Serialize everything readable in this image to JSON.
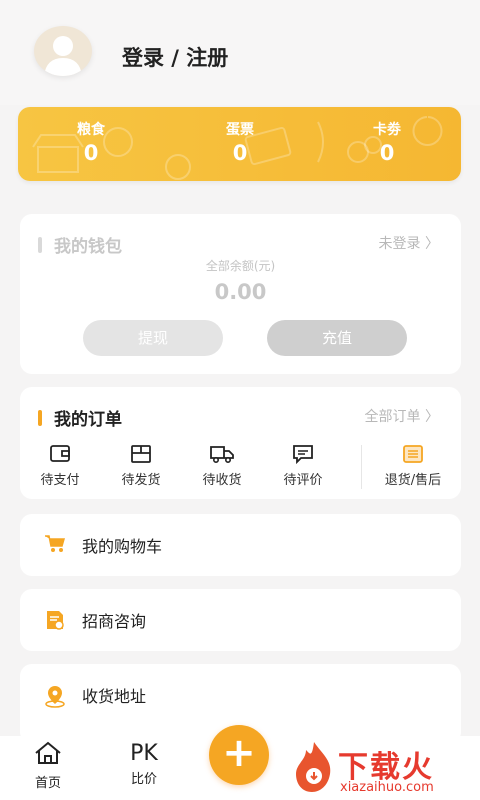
{
  "profile": {
    "login_label": "登录 / 注册"
  },
  "assets": [
    {
      "label": "粮食",
      "value": "0"
    },
    {
      "label": "蛋票",
      "value": "0"
    },
    {
      "label": "卡劵",
      "value": "0"
    }
  ],
  "wallet": {
    "title": "我的钱包",
    "status": "未登录 〉",
    "balance_label": "全部余额(元)",
    "balance": "0.00",
    "withdraw_label": "提现",
    "recharge_label": "充值"
  },
  "orders": {
    "title": "我的订单",
    "all_link": "全部订单 〉",
    "items": [
      "待支付",
      "待发货",
      "待收货",
      "待评价",
      "退货/售后"
    ]
  },
  "menu": [
    "我的购物车",
    "招商咨询",
    "收货地址"
  ],
  "tabbar": {
    "home": "首页",
    "compare": "比价",
    "compare_glyph": "PK",
    "plus": "+"
  },
  "watermark": {
    "brand": "下载火",
    "url": "xiazaihuo.com"
  },
  "colors": {
    "accent": "#f5b732",
    "order_bar": "#f5a623",
    "icon": "#f5a623"
  }
}
